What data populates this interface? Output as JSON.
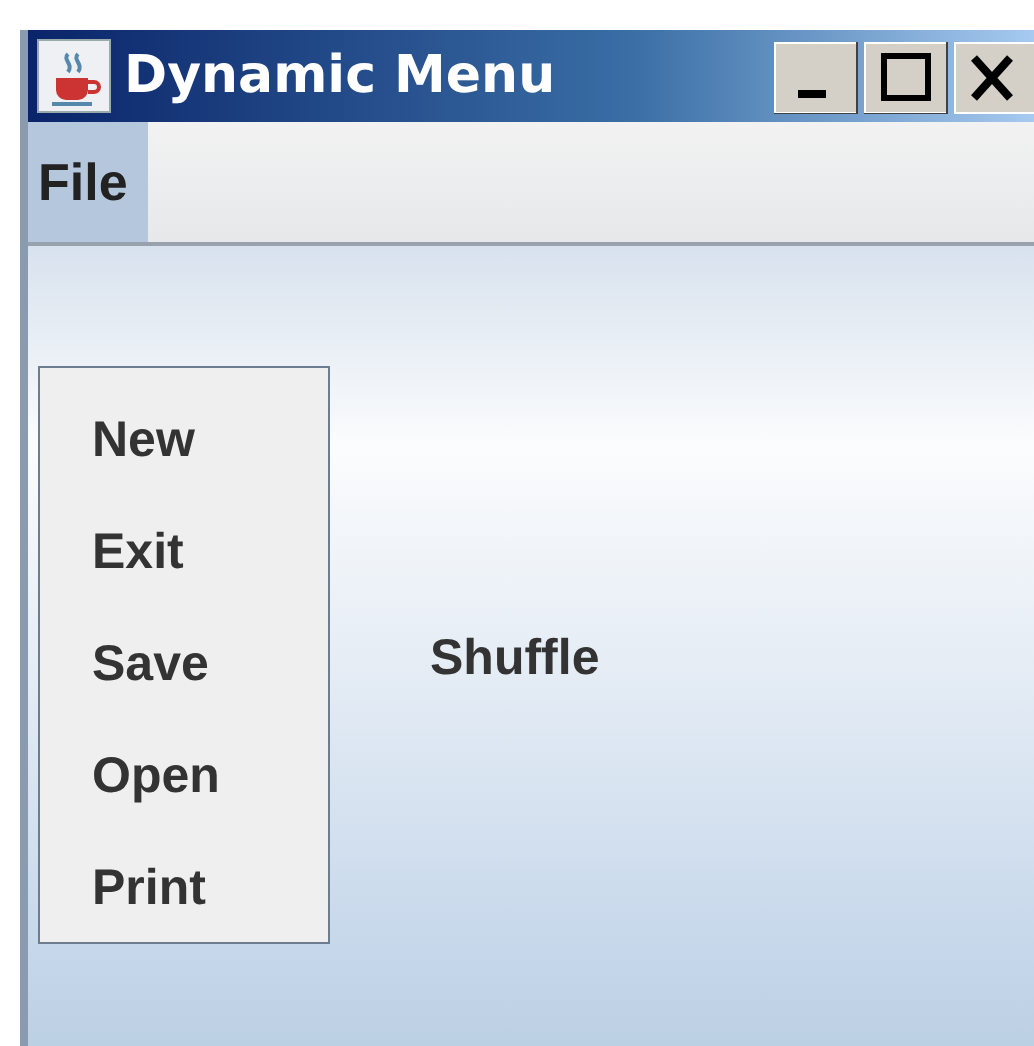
{
  "window": {
    "title": "Dynamic Menu"
  },
  "menubar": [
    {
      "label": "File",
      "selected": true
    }
  ],
  "open_menu": {
    "items": [
      {
        "label": "New"
      },
      {
        "label": "Exit"
      },
      {
        "label": "Save"
      },
      {
        "label": "Open"
      },
      {
        "label": "Print"
      }
    ]
  },
  "content": {
    "label": "Shuffle"
  }
}
